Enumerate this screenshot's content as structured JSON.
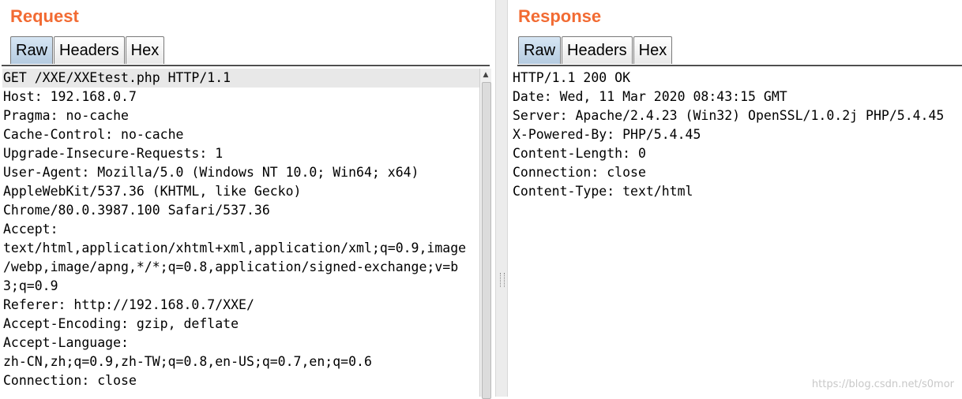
{
  "request": {
    "title": "Request",
    "tabs": [
      "Raw",
      "Headers",
      "Hex"
    ],
    "active_tab": "Raw",
    "lines": [
      "GET /XXE/XXEtest.php HTTP/1.1",
      "Host: 192.168.0.7",
      "Pragma: no-cache",
      "Cache-Control: no-cache",
      "Upgrade-Insecure-Requests: 1",
      "User-Agent: Mozilla/5.0 (Windows NT 10.0; Win64; x64)",
      "AppleWebKit/537.36 (KHTML, like Gecko)",
      "Chrome/80.0.3987.100 Safari/537.36",
      "Accept:",
      "text/html,application/xhtml+xml,application/xml;q=0.9,image",
      "/webp,image/apng,*/*;q=0.8,application/signed-exchange;v=b",
      "3;q=0.9",
      "Referer: http://192.168.0.7/XXE/",
      "Accept-Encoding: gzip, deflate",
      "Accept-Language:",
      "zh-CN,zh;q=0.9,zh-TW;q=0.8,en-US;q=0.7,en;q=0.6",
      "Connection: close"
    ]
  },
  "response": {
    "title": "Response",
    "tabs": [
      "Raw",
      "Headers",
      "Hex"
    ],
    "active_tab": "Raw",
    "lines": [
      "HTTP/1.1 200 OK",
      "Date: Wed, 11 Mar 2020 08:43:15 GMT",
      "Server: Apache/2.4.23 (Win32) OpenSSL/1.0.2j PHP/5.4.45",
      "X-Powered-By: PHP/5.4.45",
      "Content-Length: 0",
      "Connection: close",
      "Content-Type: text/html"
    ]
  },
  "icons": {
    "scroll_up": "triangle-up-icon"
  },
  "colors": {
    "title": "#f26b33",
    "active_tab": "#c6d9ec"
  },
  "watermark": "https://blog.csdn.net/s0mor"
}
